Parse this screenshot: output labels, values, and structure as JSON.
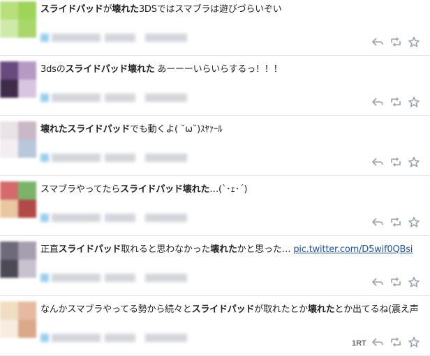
{
  "tweets": [
    {
      "segments": [
        {
          "text": "スライドパッド",
          "bold": true
        },
        {
          "text": "が",
          "bold": false
        },
        {
          "text": "壊れた",
          "bold": true
        },
        {
          "text": "3DSではスマブラは遊びづらいぞい",
          "bold": false
        }
      ],
      "link": "",
      "retweet_count": "",
      "avatar_colors": [
        "#b7e07a",
        "#9ed45a",
        "#cfe9a8",
        "#a9d76c"
      ]
    },
    {
      "segments": [
        {
          "text": "3dsの",
          "bold": false
        },
        {
          "text": "スライドパッド",
          "bold": true
        },
        {
          "text": "壊れた",
          "bold": true
        },
        {
          "text": " あーーーいらいらするっ！！！",
          "bold": false
        }
      ],
      "link": "",
      "retweet_count": "",
      "avatar_colors": [
        "#6a4a7e",
        "#b69ac4",
        "#3d2c4a",
        "#d8c6e0"
      ]
    },
    {
      "segments": [
        {
          "text": "壊れた",
          "bold": true
        },
        {
          "text": "スライドパッド",
          "bold": true
        },
        {
          "text": "でも動くよ( ˘ω˘)ｽﾔｧｰﾙ",
          "bold": false
        }
      ],
      "link": "",
      "retweet_count": "",
      "avatar_colors": [
        "#e9e3e8",
        "#c9b8c6",
        "#f2eef1",
        "#b9c7da"
      ]
    },
    {
      "segments": [
        {
          "text": "スマブラやってたら",
          "bold": false
        },
        {
          "text": "スライドパッド",
          "bold": true
        },
        {
          "text": "壊れた",
          "bold": true
        },
        {
          "text": "…(`･ｪ･´)",
          "bold": false
        }
      ],
      "link": "",
      "retweet_count": "",
      "avatar_colors": [
        "#d46a6a",
        "#7bb36b",
        "#e9c7a0",
        "#b24a4a"
      ]
    },
    {
      "segments": [
        {
          "text": "正直",
          "bold": false
        },
        {
          "text": "スライドパッド",
          "bold": true
        },
        {
          "text": "取れると思わなかった",
          "bold": false
        },
        {
          "text": "壊れた",
          "bold": true
        },
        {
          "text": "かと思った… ",
          "bold": false
        }
      ],
      "link": "pic.twitter.com/D5wif0QBsi",
      "retweet_count": "",
      "avatar_colors": [
        "#6e6a7a",
        "#a59fb0",
        "#4d4a58",
        "#c8c2cf"
      ]
    },
    {
      "segments": [
        {
          "text": "なんかスマブラやってる勢から続々と",
          "bold": false
        },
        {
          "text": "スライドパッド",
          "bold": true
        },
        {
          "text": "が取れたとか",
          "bold": false
        },
        {
          "text": "壊れた",
          "bold": true
        },
        {
          "text": "とか出てるね(震え声",
          "bold": false
        }
      ],
      "link": "",
      "retweet_count": "1RT",
      "avatar_colors": [
        "#f0ddc2",
        "#e6b9a0",
        "#f6ece0",
        "#d9a98a"
      ]
    }
  ],
  "colors": {
    "link": "#2255a5",
    "meta_blue": "#7ec3ea",
    "meta_gray": "#c9ccd3",
    "action_icon": "#9aa3b0"
  },
  "icons": [
    "reply-icon",
    "retweet-icon",
    "favorite-icon"
  ]
}
